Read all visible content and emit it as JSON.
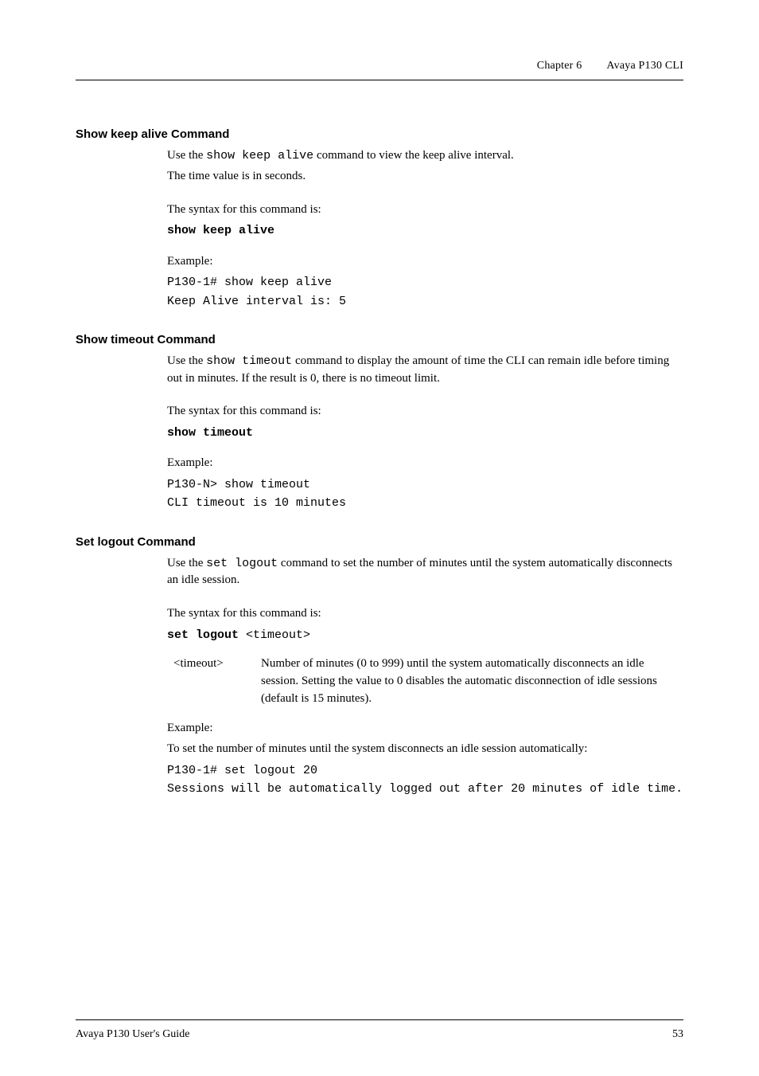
{
  "header": {
    "chapter_label": "Chapter 6",
    "chapter_title": "Avaya P130 CLI"
  },
  "sections": {
    "keepalive": {
      "title": "Show keep alive Command",
      "intro_1_pre": "Use the ",
      "intro_1_code": "show keep alive",
      "intro_1_post": " command to view the keep alive interval.",
      "intro_2": "The time value is in seconds.",
      "syntax_label": "The syntax for this command is:",
      "syntax_code": "show keep alive",
      "example_label": "Example:",
      "example_line1": "P130-1# show keep alive",
      "example_line2": "Keep Alive interval is: 5"
    },
    "timeout": {
      "title": "Show timeout Command",
      "intro_pre": "Use the ",
      "intro_code": "show timeout",
      "intro_post": " command to display the amount of time the CLI can remain idle before timing out in minutes. If the result is 0, there is no timeout limit.",
      "syntax_label": "The syntax for this command is:",
      "syntax_code": "show timeout",
      "example_label": "Example:",
      "example_line1": "P130-N> show timeout",
      "example_line2": "CLI timeout is 10 minutes"
    },
    "setlogout": {
      "title": "Set logout Command",
      "intro_pre": "Use the ",
      "intro_code": "set logout",
      "intro_post": " command to set the number of minutes until the system automatically disconnects an idle session.",
      "syntax_label": "The syntax for this command is:",
      "syntax_code_bold": "set logout",
      "syntax_code_arg": " <timeout>",
      "param_term": "<timeout>",
      "param_desc": "Number of minutes (0 to 999) until the system automatically disconnects an idle session. Setting the value to 0 disables the automatic disconnection of idle sessions (default is 15 minutes).",
      "example_label": "Example:",
      "example_intro": "To set the number of minutes until the system disconnects an idle session automatically:",
      "example_line1": "P130-1# set logout 20",
      "example_line2": "Sessions will be automatically logged out after 20 minutes of idle time."
    }
  },
  "footer": {
    "guide": "Avaya P130 User's Guide",
    "page": "53"
  }
}
